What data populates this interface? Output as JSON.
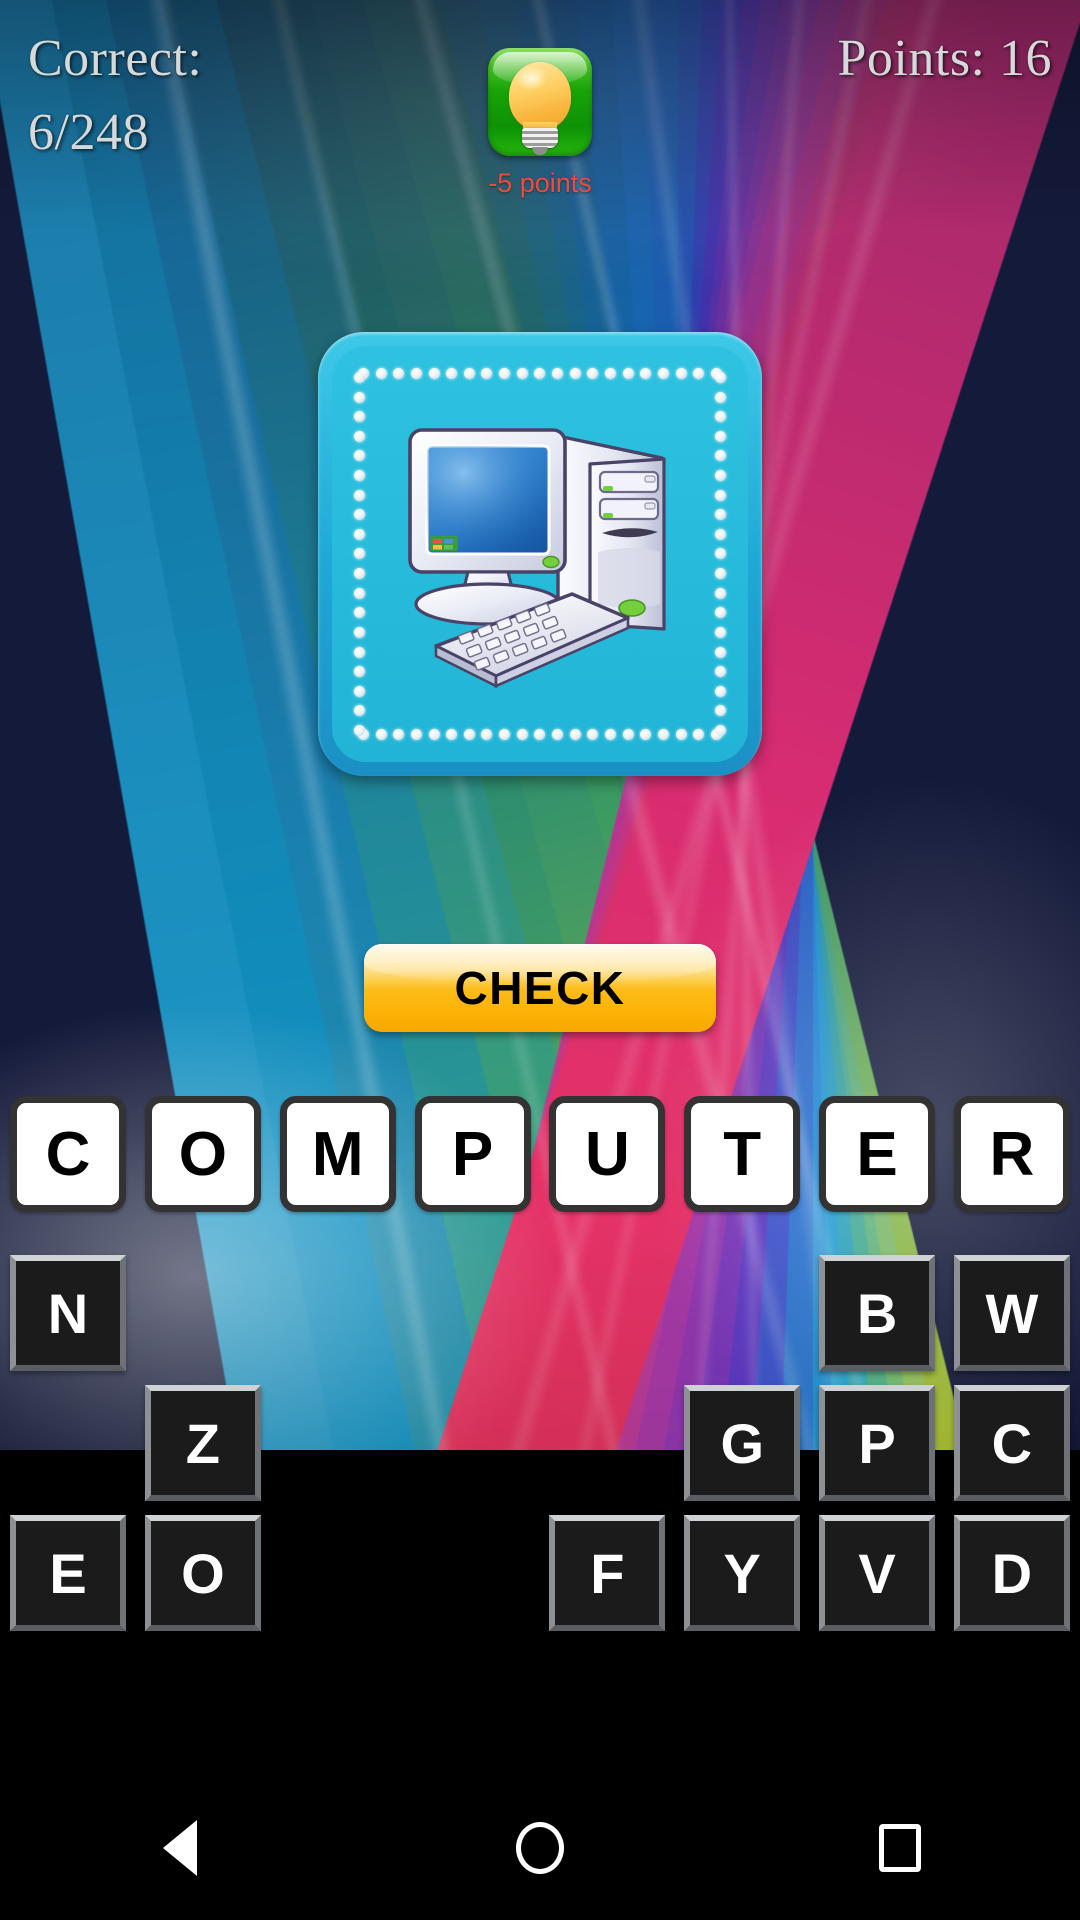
{
  "header": {
    "correct_label": "Correct:",
    "correct_value": "6/248",
    "points_text": "Points: 16"
  },
  "hint": {
    "icon": "lightbulb-icon",
    "cost_text": "-5 points"
  },
  "card": {
    "image_alt": "desktop-computer-illustration",
    "bg_color": "#21b4d6",
    "frame_color": "#1fa9d6"
  },
  "check_button": {
    "label": "CHECK",
    "color": "#fdbc18"
  },
  "answer": {
    "word": "COMPUTER",
    "letters": [
      "C",
      "O",
      "M",
      "P",
      "U",
      "T",
      "E",
      "R"
    ]
  },
  "letter_bank": {
    "rows": [
      [
        "N",
        "",
        "",
        "",
        "",
        "",
        "B",
        "W"
      ],
      [
        "",
        "Z",
        "",
        "",
        "",
        "G",
        "P",
        "C"
      ],
      [
        "E",
        "O",
        "",
        "",
        "F",
        "Y",
        "V",
        "D"
      ]
    ]
  },
  "navbar": {
    "back": "back-icon",
    "home": "home-icon",
    "recents": "recents-icon"
  },
  "colors": {
    "hud_text": "#d6d9da",
    "hint_cost": "#f4473f",
    "key_bg": "#1b1b1b",
    "slot_bg": "#ffffff"
  }
}
